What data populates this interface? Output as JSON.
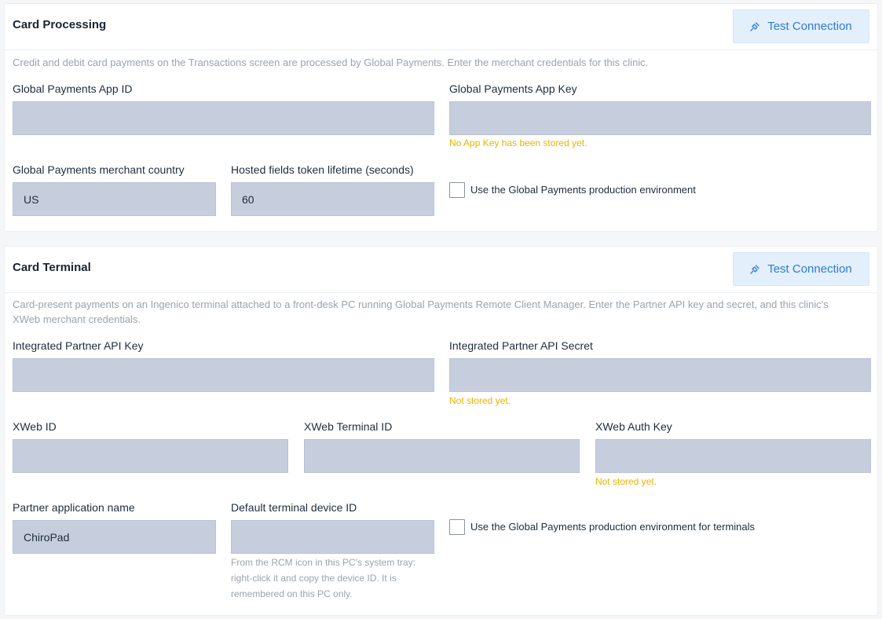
{
  "card_processing": {
    "title": "Card Processing",
    "test_button": "Test Connection",
    "description": "Credit and debit card payments on the Transactions screen are processed by Global Payments. Enter the merchant credentials for this clinic.",
    "app_id": {
      "label": "Global Payments App ID",
      "value": ""
    },
    "app_key": {
      "label": "Global Payments App Key",
      "value": "",
      "note": "No App Key has been stored yet."
    },
    "merchant_country": {
      "label": "Global Payments merchant country",
      "value": "US"
    },
    "token_lifetime": {
      "label": "Hosted fields token lifetime (seconds)",
      "value": "60"
    },
    "production_checkbox": {
      "label": "Use the Global Payments production environment",
      "checked": false
    }
  },
  "card_terminal": {
    "title": "Card Terminal",
    "test_button": "Test Connection",
    "description": "Card-present payments on an Ingenico terminal attached to a front-desk PC running Global Payments Remote Client Manager. Enter the Partner API key and secret, and this clinic's XWeb merchant credentials.",
    "partner_api_key": {
      "label": "Integrated Partner API Key",
      "value": ""
    },
    "partner_api_secret": {
      "label": "Integrated Partner API Secret",
      "value": "",
      "note": "Not stored yet."
    },
    "xweb_id": {
      "label": "XWeb ID",
      "value": ""
    },
    "xweb_terminal_id": {
      "label": "XWeb Terminal ID",
      "value": ""
    },
    "xweb_auth_key": {
      "label": "XWeb Auth Key",
      "value": "",
      "note": "Not stored yet."
    },
    "partner_app_name": {
      "label": "Partner application name",
      "value": "ChiroPad"
    },
    "default_device_id": {
      "label": "Default terminal device ID",
      "value": "",
      "help": "From the RCM icon in this PC's system tray: right-click it and copy the device ID. It is remembered on this PC only."
    },
    "production_checkbox": {
      "label": "Use the Global Payments production environment for terminals",
      "checked": false
    }
  },
  "colors": {
    "accent": "#2f7bd0",
    "button_bg": "#e3effb",
    "field_bg": "#c6cedd",
    "warning": "#e8b400",
    "muted": "#9aa3ae"
  },
  "icons": {
    "test_connection": "plug-icon"
  }
}
